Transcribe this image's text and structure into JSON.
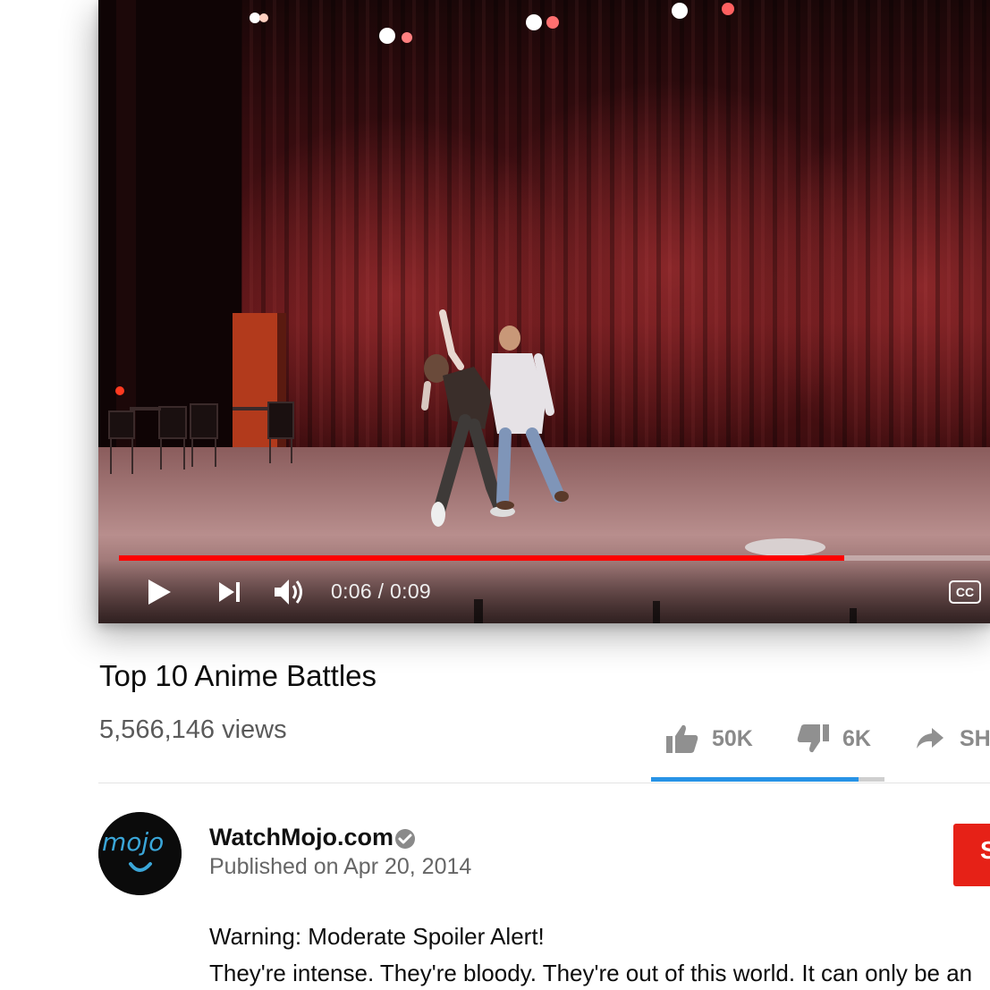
{
  "player": {
    "current_time": "0:06",
    "duration": "0:09",
    "time_separator": " / ",
    "progress_fraction": 0.83,
    "cc_label": "CC",
    "progress_color": "#ff0000"
  },
  "video": {
    "title": "Top 10 Anime Battles",
    "views": "5,566,146 views"
  },
  "actions": {
    "like_count": "50K",
    "dislike_count": "6K",
    "share_label": "SH",
    "like_fraction": 0.89,
    "like_bar_color": "#2793e6"
  },
  "channel": {
    "name": "WatchMojo.com",
    "published": "Published on Apr 20, 2014",
    "avatar_text": "mojo",
    "subscribe_label": "S",
    "subscribe_color": "#e62117"
  },
  "description": {
    "line1": "Warning: Moderate Spoiler Alert!",
    "line2": "They're intense. They're bloody. They're out of this world. It can only be an"
  }
}
